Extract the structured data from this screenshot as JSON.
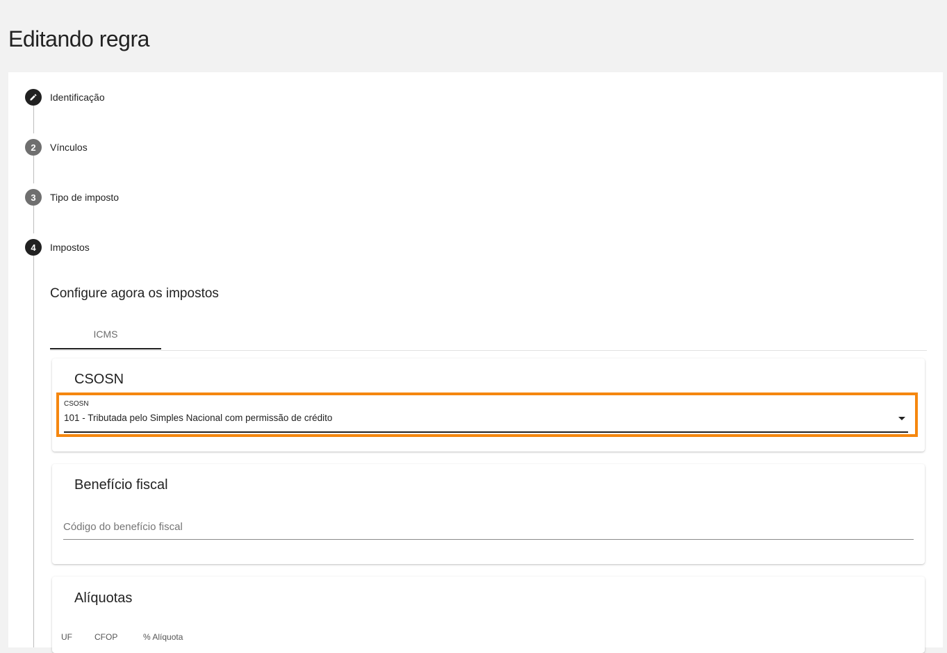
{
  "page": {
    "title": "Editando regra"
  },
  "stepper": {
    "steps": [
      {
        "number": "",
        "label": "Identificação",
        "icon": "pencil-icon",
        "state": "done"
      },
      {
        "number": "2",
        "label": "Vínculos",
        "state": "idle"
      },
      {
        "number": "3",
        "label": "Tipo de imposto",
        "state": "idle"
      },
      {
        "number": "4",
        "label": "Impostos",
        "state": "active"
      }
    ]
  },
  "content": {
    "heading": "Configure agora os impostos",
    "tabs": [
      {
        "label": "ICMS",
        "selected": true
      }
    ]
  },
  "csosn_card": {
    "title": "CSOSN",
    "field_label": "CSOSN",
    "selected_value": "101 - Tributada pelo Simples Nacional com permissão de crédito",
    "highlight_color": "#f5870f"
  },
  "beneficio_card": {
    "title": "Benefício fiscal",
    "placeholder": "Código do benefício fiscal",
    "value": ""
  },
  "aliquotas_card": {
    "title": "Alíquotas",
    "columns": [
      "UF",
      "CFOP",
      "% Alíquota"
    ]
  }
}
